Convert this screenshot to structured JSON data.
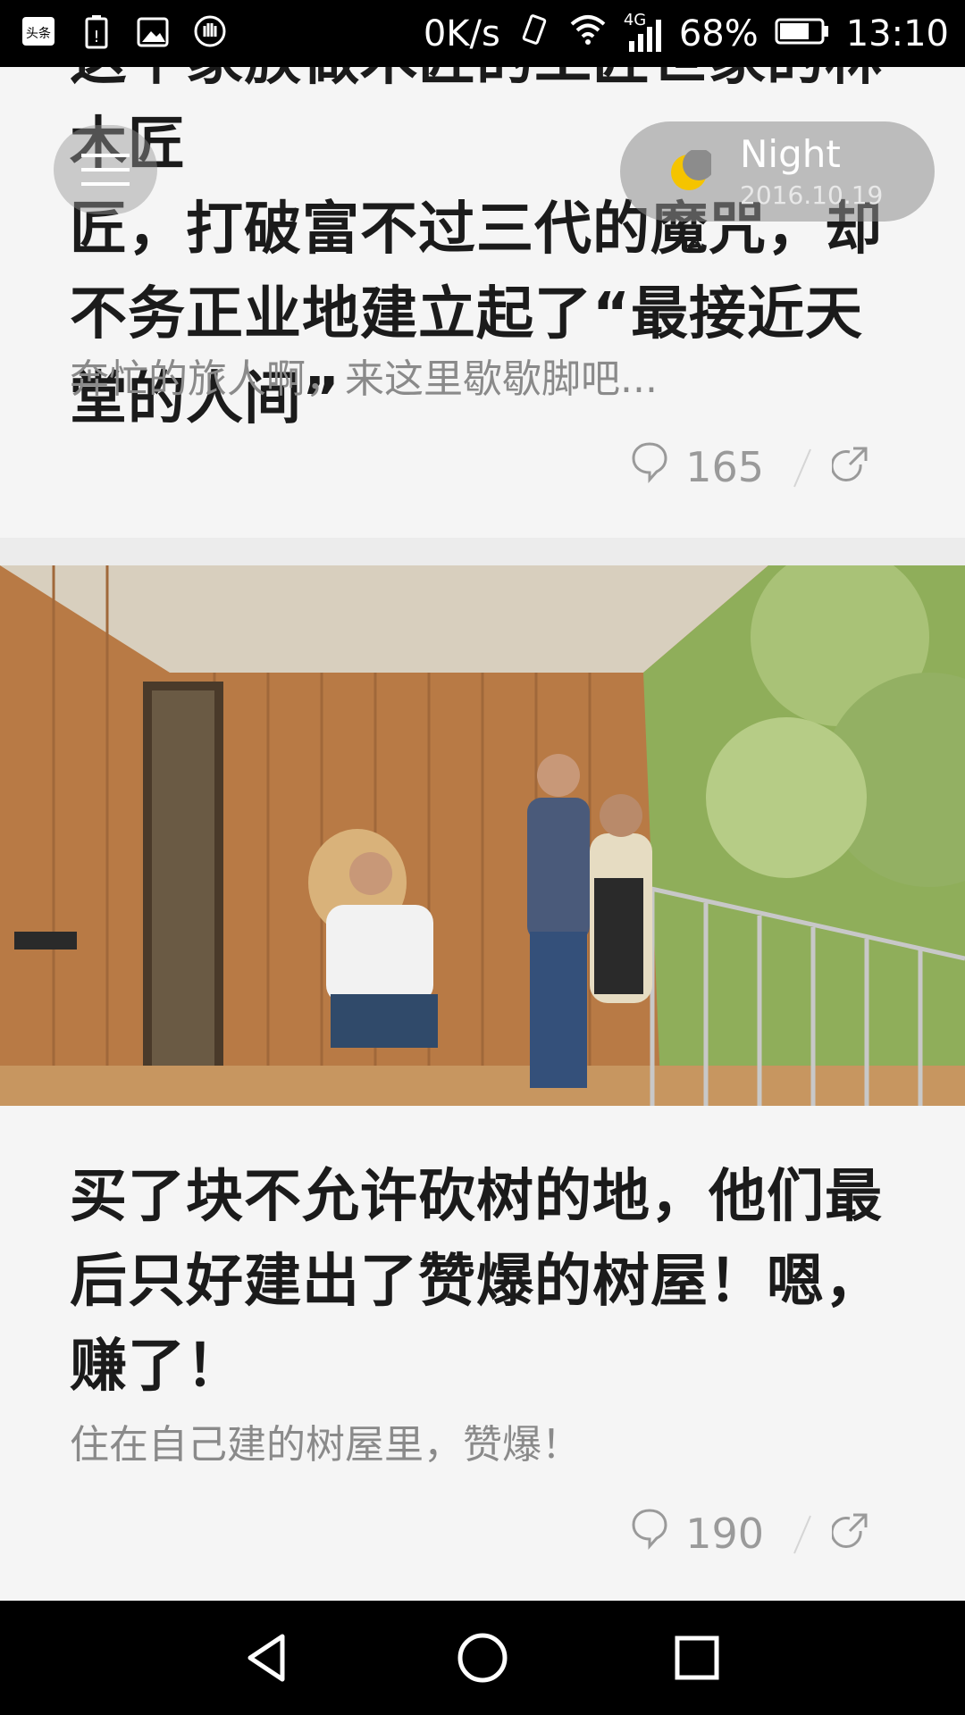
{
  "status_bar": {
    "speed": "0K/s",
    "network": "4G",
    "battery": "68%",
    "time": "13:10",
    "left_icons": [
      "toutiao-app-icon",
      "battery-alert-icon",
      "image-icon",
      "hand-icon"
    ]
  },
  "overlay": {
    "night_label": "Night",
    "night_date": "2016.10.19"
  },
  "articles": [
    {
      "title_partial_top": "这个家族做木匠的工匠世家的林木匠",
      "title_line1": "匠，打破富不过三代的魔咒，却",
      "title_line2": "不务正业地建立起了“最接近天",
      "title_line3": "堂的人间”",
      "subtitle": "奔忙的旅人啊，来这里歇歇脚吧...",
      "comments": "165"
    },
    {
      "title_line1": "买了块不允许砍树的地，他们最",
      "title_line2": "后只好建出了赞爆的树屋！嗯，",
      "title_line3": "赚了！",
      "subtitle": "住在自己建的树屋里，赞爆！",
      "comments": "190"
    }
  ],
  "colors": {
    "accent_moon": "#f5c400",
    "background": "#f5f5f5"
  }
}
